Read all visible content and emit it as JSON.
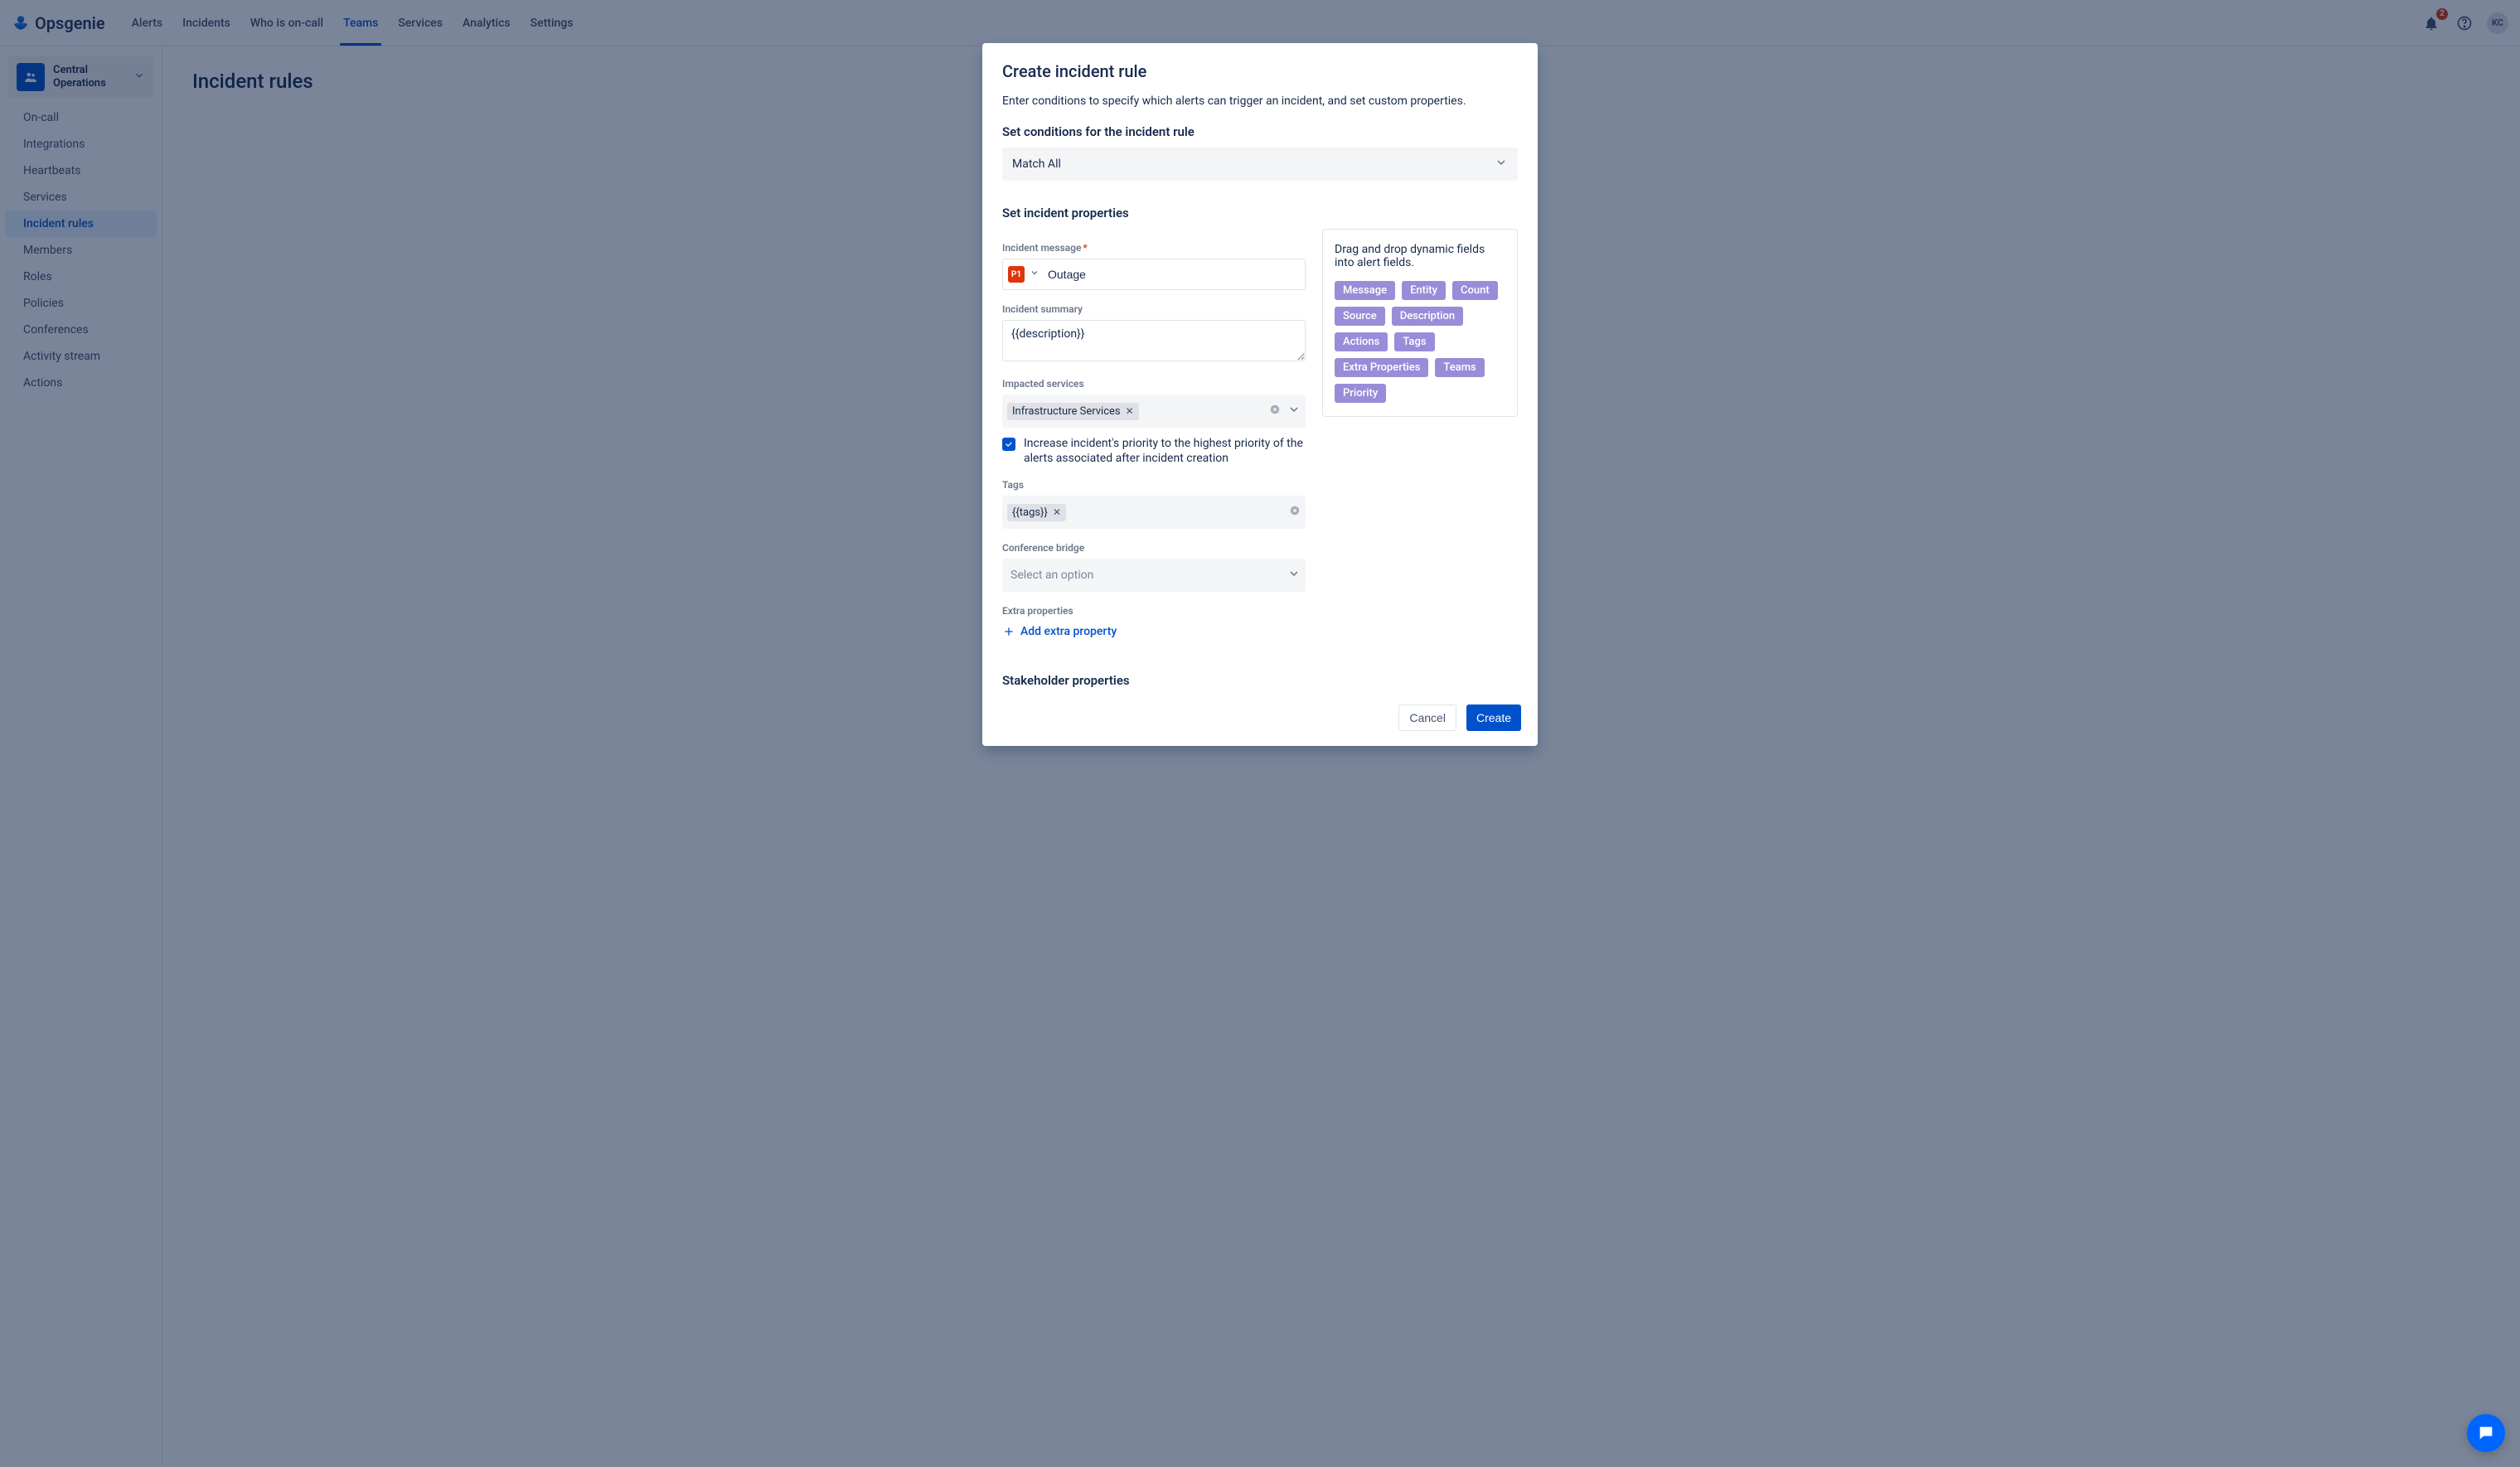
{
  "brand": "Opsgenie",
  "nav": {
    "items": [
      "Alerts",
      "Incidents",
      "Who is on-call",
      "Teams",
      "Services",
      "Analytics",
      "Settings"
    ],
    "active_index": 3
  },
  "notifications": {
    "count": "2"
  },
  "user": {
    "initials": "KC"
  },
  "team": {
    "name": "Central Operations"
  },
  "sidebar": {
    "items": [
      "On-call",
      "Integrations",
      "Heartbeats",
      "Services",
      "Incident rules",
      "Members",
      "Roles",
      "Policies",
      "Conferences",
      "Activity stream",
      "Actions"
    ],
    "selected_index": 4
  },
  "page": {
    "title": "Incident rules"
  },
  "modal": {
    "title": "Create incident rule",
    "hint": "Enter conditions to specify which alerts can trigger an incident, and set custom properties.",
    "conditions_section": "Set conditions for the incident rule",
    "match_value": "Match All",
    "properties_section": "Set incident properties",
    "msg_label": "Incident message",
    "priority_badge": "P1",
    "message_value": "Outage",
    "summary_label": "Incident summary",
    "summary_value": "{{description}}",
    "services_label": "Impacted services",
    "services_tags": [
      "Infrastructure Services"
    ],
    "increase_priority": "Increase incident's priority to the highest priority of the alerts associated after incident creation",
    "tags_label": "Tags",
    "tags_values": [
      "{{tags}}"
    ],
    "bridge_label": "Conference bridge",
    "bridge_placeholder": "Select an option",
    "extra_label": "Extra properties",
    "add_extra": "Add extra property",
    "stakeholder_section": "Stakeholder properties",
    "right_hint": "Drag and drop dynamic fields into alert fields.",
    "dyn_fields": [
      "Message",
      "Entity",
      "Count",
      "Source",
      "Description",
      "Actions",
      "Tags",
      "Extra Properties",
      "Teams",
      "Priority"
    ],
    "cancel": "Cancel",
    "create": "Create"
  }
}
